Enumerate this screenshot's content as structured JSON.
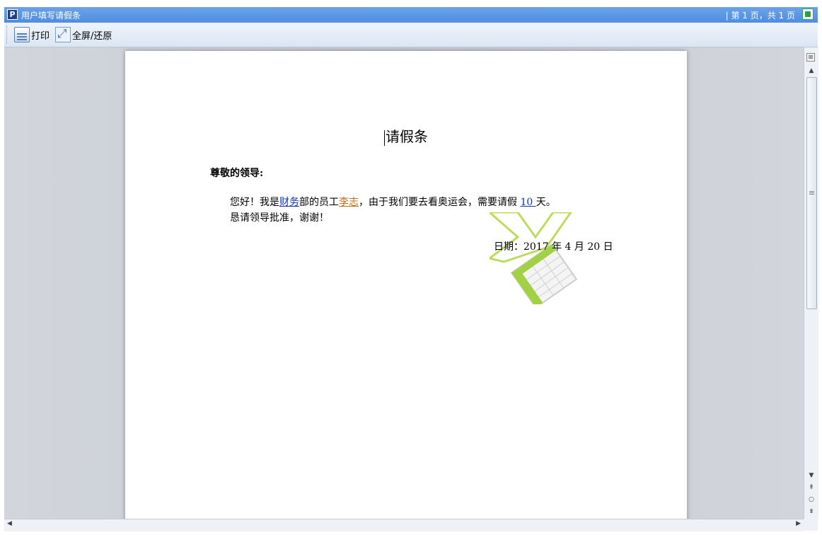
{
  "window": {
    "app_icon_letter": "P",
    "title": "用户填写请假条",
    "page_info": "| 第 1 页，共 1 页"
  },
  "toolbar": {
    "print_label": "打印",
    "fullscreen_label": "全屏/还原"
  },
  "document": {
    "title": "请假条",
    "greeting": "尊敬的领导:",
    "line1_part1": "您好！我是",
    "department": "财务",
    "line1_part2": "部的员工",
    "employee": "李志",
    "line1_part3": "，由于我们要去看奥运会，需要请假 ",
    "days": "10 ",
    "line1_part4": "天。",
    "line2": "恳请领导批准，谢谢！",
    "date": "日期：2017 年 4 月 20 日"
  },
  "colors": {
    "titlebar": "#4f8de0",
    "field_blue": "#1133aa",
    "field_orange": "#d06a10",
    "watermark_green": "#9acd32"
  },
  "icons": {
    "print": "printer-icon",
    "fullscreen": "fullscreen-icon",
    "watermark": "excel-logo-icon"
  }
}
